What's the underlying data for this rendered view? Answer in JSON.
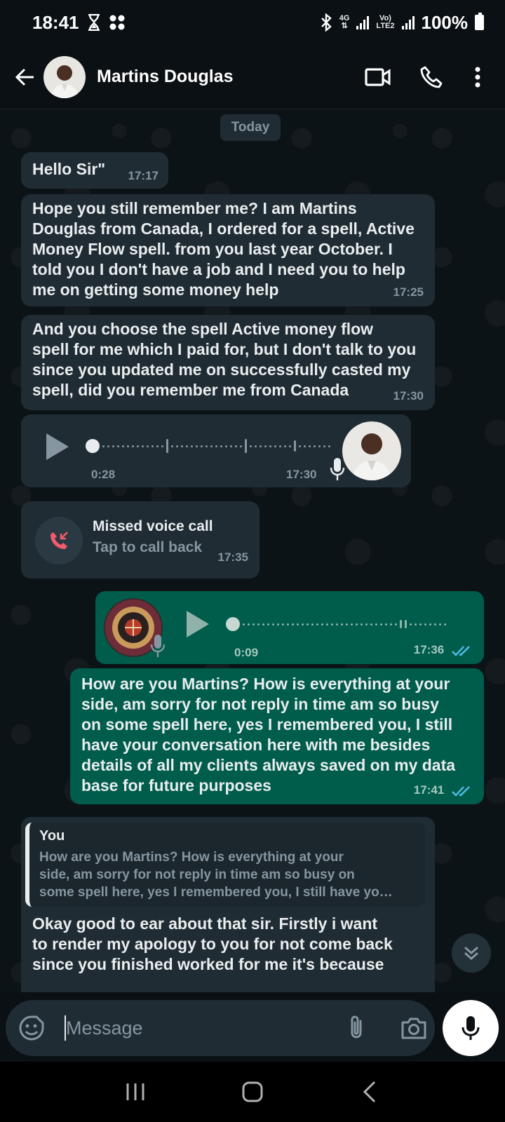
{
  "status_bar": {
    "time": "18:41",
    "network_4g": "4G",
    "volte_top": "Vo)",
    "volte_bottom": "LTE2",
    "battery": "100%",
    "icons": [
      "hourglass-icon",
      "dots-grid-icon",
      "bluetooth-icon",
      "signal-icon",
      "battery-icon"
    ]
  },
  "header": {
    "contact_name": "Martins Douglas",
    "icons": [
      "back-arrow-icon",
      "video-call-icon",
      "phone-icon",
      "more-vert-icon"
    ]
  },
  "chat": {
    "date_chip": "Today",
    "messages": [
      {
        "type": "text",
        "direction": "in",
        "text": "Hello Sir\"",
        "time": "17:17"
      },
      {
        "type": "text",
        "direction": "in",
        "lines": [
          "Hope you still remember me? I am Martins",
          "Douglas from Canada, I ordered for a spell, Active",
          "Money Flow spell. from you last year October. I",
          "told you I don't have a job and I need you to help",
          "me on getting some money help"
        ],
        "time": "17:25"
      },
      {
        "type": "text",
        "direction": "in",
        "lines": [
          "And you choose the spell Active money flow",
          "spell for me which I paid for, but I don't talk to you",
          "since you updated me on successfully casted my",
          "spell, did you remember me from Canada"
        ],
        "time": "17:30"
      },
      {
        "type": "voice",
        "direction": "in",
        "duration": "0:28",
        "time": "17:30"
      },
      {
        "type": "missed_call",
        "direction": "in",
        "title": "Missed voice call",
        "subtitle": "Tap to call back",
        "time": "17:35"
      },
      {
        "type": "voice",
        "direction": "out",
        "duration": "0:09",
        "time": "17:36",
        "status": "read"
      },
      {
        "type": "text",
        "direction": "out",
        "lines": [
          "How are you Martins? How is everything at your",
          "side, am sorry for not reply in time am so busy",
          "on some spell here, yes I remembered you, I still",
          "have your conversation here with me besides",
          "details of all my clients always saved on my data",
          "base for future purposes"
        ],
        "time": "17:41",
        "status": "read"
      },
      {
        "type": "reply",
        "direction": "in",
        "quote_author": "You",
        "quote_lines": [
          "How are you Martins? How is everything at your",
          "side, am sorry for not reply in time am so busy on",
          "some spell here, yes I remembered you, I still  have yo…"
        ],
        "lines": [
          "Okay good to ear about that sir. Firstly i want",
          "to render my apology to you for not come back",
          "since you finished worked for me it's because"
        ]
      }
    ]
  },
  "composer": {
    "placeholder": "Message",
    "icons": [
      "sticker-icon",
      "attach-icon",
      "camera-icon",
      "mic-icon"
    ]
  },
  "colors": {
    "background": "#0b1014",
    "incoming_bubble": "#202c33",
    "outgoing_bubble": "#005c4b",
    "read_ticks": "#53bdeb",
    "missed_call": "#f15c6d"
  }
}
